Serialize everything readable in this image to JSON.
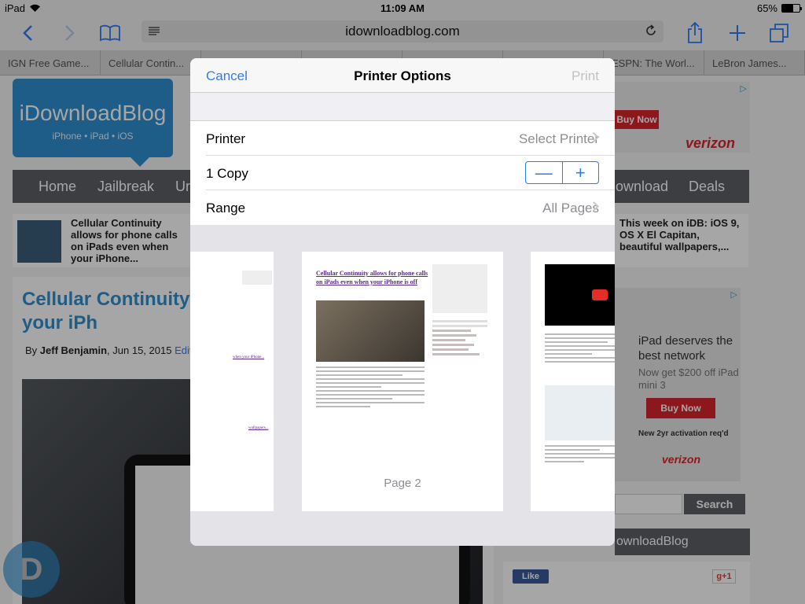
{
  "status_bar": {
    "device": "iPad",
    "time": "11:09 AM",
    "battery": "65%",
    "battery_level": 0.65
  },
  "toolbar": {
    "url": "idownloadblog.com"
  },
  "tabs": [
    "IGN Free Game...",
    "Cellular Contin...",
    "",
    "",
    "",
    "",
    "ESPN: The Worl...",
    "LeBron James..."
  ],
  "page": {
    "logo_title": "iDownloadBlog",
    "logo_sub": "iPhone • iPad • iOS",
    "nav": [
      "Home",
      "Jailbreak",
      "Ur",
      "ownload",
      "Deals"
    ],
    "ad_top": {
      "button": "Buy Now",
      "brand": "verizon"
    },
    "trending_left": "Cellular Continuity allows for phone calls on iPads even when your iPhone...",
    "trending_right": "This week on iDB: iOS 9, OS X El Capitan, beautiful wallpapers,...",
    "article_title": "Cellular Continuity even when your iPh",
    "byline_prefix": "By ",
    "byline_author": "Jeff Benjamin",
    "byline_date": ", Jun 15, 2015 ",
    "byline_edit": "Edit",
    "ad_side": {
      "headline": "iPad deserves the best network",
      "offer": "Now get $200 off iPad mini 3",
      "button": "Buy Now",
      "fine_print": "New 2yr activation req'd",
      "brand": "verizon"
    },
    "search_button": "Search",
    "follow_heading": "ownloadBlog",
    "fb_like": "Like",
    "gplus": "g+1",
    "badge": "D"
  },
  "dialog": {
    "cancel": "Cancel",
    "title": "Printer Options",
    "print": "Print",
    "printer_label": "Printer",
    "printer_value": "Select Printer",
    "copies_label": "1 Copy",
    "range_label": "Range",
    "range_value": "All Pages",
    "stepper_minus": "—",
    "stepper_plus": "+",
    "preview_title": "Cellular Continuity allows for phone calls on iPads even when your iPhone is off",
    "preview_page_label": "Page 2",
    "preview_left_link1": "when your iPhone...",
    "preview_left_link2": "wallpapers..."
  }
}
